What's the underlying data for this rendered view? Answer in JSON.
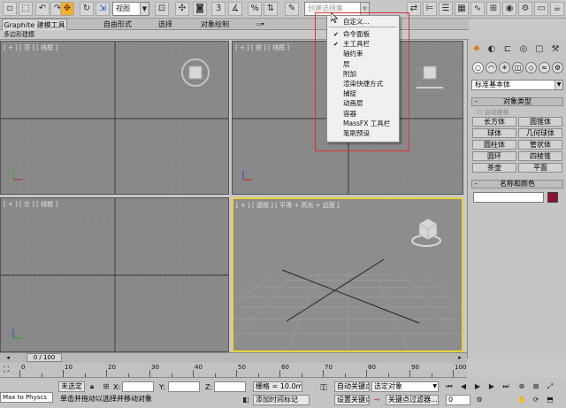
{
  "toolbar": {
    "view_dropdown": "视图",
    "selection_set_placeholder": "创建选择集",
    "tool_icons": [
      "select-icon",
      "select-region-icon",
      "undo-icon",
      "redo-icon",
      "link-icon",
      "unlink-icon",
      "bind-icon",
      "filter-icon",
      "select-object-icon",
      "select-by-name-icon",
      "rect-select-icon",
      "window-crossing-icon",
      "move-icon",
      "rotate-icon",
      "scale-icon",
      "pivot-icon",
      "select-manipulate-icon",
      "keyboard-shortcut-icon",
      "snap-3-icon",
      "angle-snap-icon",
      "percent-snap-icon",
      "spinner-snap-icon",
      "edit-named-sel-icon",
      "mirror-icon",
      "align-icon",
      "layer-icon",
      "graphite-icon",
      "curve-editor-icon",
      "schematic-icon",
      "material-icon",
      "render-setup-icon",
      "render-frame-icon",
      "render-icon"
    ],
    "labels": {
      "snap3": "3",
      "snap_pct": "%"
    }
  },
  "ribbon": {
    "tabs": [
      "Graphite 建模工具",
      "自由形式",
      "选择",
      "对象绘制"
    ],
    "active_tab": 0,
    "sub_label": "多边形建模"
  },
  "viewports": [
    {
      "id": "top",
      "label": "[ + ] [ 顶 ] [ 线框 ]",
      "active": false
    },
    {
      "id": "front",
      "label": "[ + ] [ 前 ] [ 线框 ]",
      "active": false
    },
    {
      "id": "left",
      "label": "[ + ] [ 左 ] [ 线框 ]",
      "active": false
    },
    {
      "id": "perspective",
      "label": "[ + ] [ 透视 ] [ 平滑 + 高光 + 边面 ]",
      "active": true
    }
  ],
  "context_menu": {
    "header": "自定义...",
    "items": [
      {
        "label": "命令面板",
        "checked": true
      },
      {
        "label": "主工具栏",
        "checked": true
      },
      {
        "label": "轴约束",
        "checked": false
      },
      {
        "label": "层",
        "checked": false
      },
      {
        "label": "附加",
        "checked": false
      },
      {
        "label": "渲染快捷方式",
        "checked": false
      },
      {
        "label": "捕捉",
        "checked": false
      },
      {
        "label": "动画层",
        "checked": false
      },
      {
        "label": "容器",
        "checked": false
      },
      {
        "label": "MassFX 工具栏",
        "checked": false
      },
      {
        "label": "笔刷预设",
        "checked": false
      }
    ]
  },
  "command_panel": {
    "tab_icons": [
      "create-icon",
      "modify-icon",
      "hierarchy-icon",
      "motion-icon",
      "display-icon",
      "utilities-icon"
    ],
    "sub_icons": [
      "geometry-icon",
      "shapes-icon",
      "lights-icon",
      "cameras-icon",
      "helpers-icon",
      "spacewarps-icon",
      "systems-icon"
    ],
    "category_dropdown": "标准基本体",
    "object_type_title": "对象类型",
    "autogrid_label": "自动栅格",
    "objects": [
      "长方体",
      "圆锥体",
      "球体",
      "几何球体",
      "圆柱体",
      "管状体",
      "圆环",
      "四棱锥",
      "茶壶",
      "平面"
    ],
    "name_color_title": "名称和颜色",
    "swatch_color": "#8c1030"
  },
  "timeline": {
    "slider_label": "0 / 100",
    "ticks": [
      "0",
      "10",
      "20",
      "30",
      "40",
      "50",
      "60",
      "70",
      "80",
      "90",
      "100"
    ]
  },
  "status": {
    "maxscript": "Max to Physcs",
    "none_selected": "未选定",
    "x_label": "X:",
    "y_label": "Y:",
    "z_label": "Z:",
    "grid": "栅格 = 10.0mm",
    "auto_key": "自动关键点",
    "set_key": "设置关键点",
    "selected_dropdown": "选定对象",
    "key_filters": "关键点过滤器...",
    "prompt": "单击并拖动以选择并移动对象",
    "add_time_tag": "添加时间标记",
    "frame_value": "0"
  }
}
